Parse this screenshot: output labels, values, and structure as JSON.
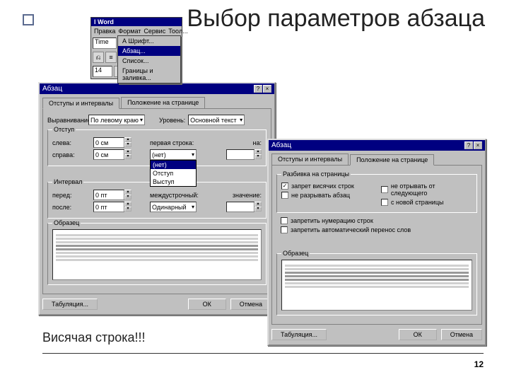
{
  "slide": {
    "title": "Выбор параметров абзаца",
    "footer": "Висячая строка!!!",
    "page": "12"
  },
  "word": {
    "title": "l Word",
    "menu": {
      "m1": "Правка",
      "m2": "Формат",
      "m3": "Сервис",
      "m4": "Тоoл..."
    },
    "font": "Time",
    "size": "14",
    "menu_items": {
      "i1": "А Шрифт...",
      "i2": "Абзац...",
      "i3": "Список...",
      "i4": "Границы и заливка..."
    }
  },
  "dlg1": {
    "title": "Абзац",
    "tab1": "Отступы и интервалы",
    "tab2": "Положение на странице",
    "align_lbl": "Выравнивание:",
    "align_val": "По левому краю",
    "level_lbl": "Уровень:",
    "level_val": "Основной текст",
    "grp_indent": "Отступ",
    "left_lbl": "слева:",
    "left_val": "0 см",
    "right_lbl": "справа:",
    "right_val": "0 см",
    "first_lbl": "первая строка:",
    "first_on_lbl": "на:",
    "dd_sel": "(нет)",
    "dd_o1": "(нет)",
    "dd_o2": "Отступ",
    "dd_o3": "Выступ",
    "grp_spacing": "Интервал",
    "before_lbl": "перед:",
    "before_val": "0 пт",
    "after_lbl": "после:",
    "after_val": "0 пт",
    "line_lbl": "междустрочный:",
    "line_val": "Одинарный",
    "line_on_lbl": "значение:",
    "grp_preview": "Образец",
    "btn_tabs": "Табуляция...",
    "btn_ok": "ОК",
    "btn_cancel": "Отмена"
  },
  "dlg2": {
    "title": "Абзац",
    "tab1": "Отступы и интервалы",
    "tab2": "Положение на странице",
    "grp_pag": "Разбивка на страницы",
    "c1": "запрет висячих строк",
    "c2": "не разрывать абзац",
    "c3": "не отрывать от следующего",
    "c4": "с новой страницы",
    "c5": "запретить нумерацию строк",
    "c6": "запретить автоматический перенос слов",
    "grp_preview": "Образец",
    "btn_tabs": "Табуляция...",
    "btn_ok": "ОК",
    "btn_cancel": "Отмена"
  }
}
